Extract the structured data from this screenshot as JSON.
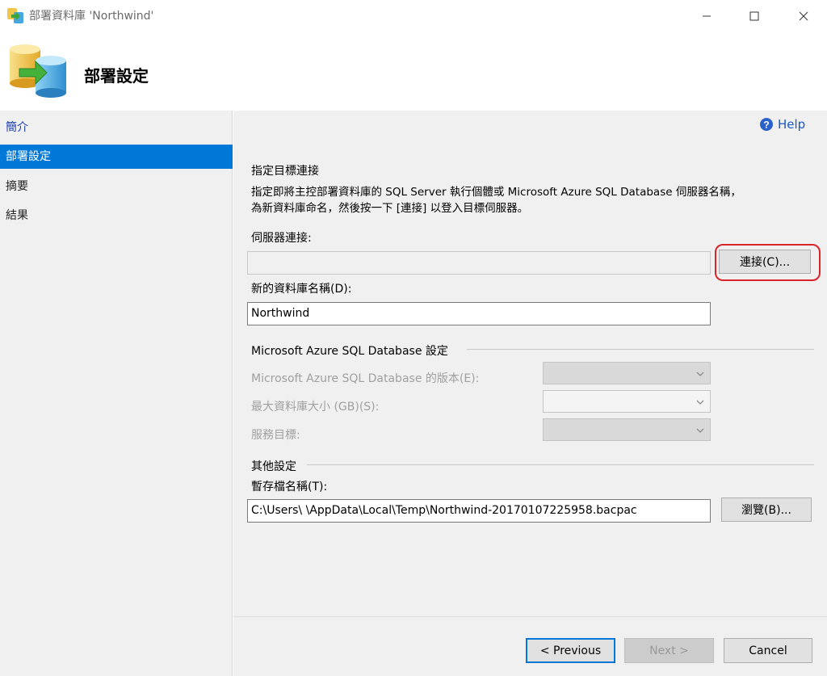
{
  "window": {
    "title": "部署資料庫 'Northwind'"
  },
  "header": {
    "title": "部署設定"
  },
  "sidebar": {
    "items": [
      {
        "label": "簡介"
      },
      {
        "label": "部署設定"
      },
      {
        "label": "摘要"
      },
      {
        "label": "結果"
      }
    ]
  },
  "help": {
    "label": "Help"
  },
  "target": {
    "heading": "指定目標連接",
    "description_line1": "指定即將主控部署資料庫的 SQL Server 執行個體或 Microsoft Azure SQL Database 伺服器名稱，",
    "description_line2": "為新資料庫命名，然後按一下 [連接] 以登入目標伺服器。",
    "server_label": "伺服器連接:",
    "server_value": "",
    "connect_button": "連接(C)...",
    "db_name_label": "新的資料庫名稱(D):",
    "db_name_value": "Northwind"
  },
  "azure": {
    "group_label": "Microsoft Azure SQL Database 設定",
    "edition_label": "Microsoft Azure SQL Database 的版本(E):",
    "max_size_label": "最大資料庫大小 (GB)(S):",
    "service_label": "服務目標:"
  },
  "other": {
    "group_label": "其他設定",
    "temp_file_label": "暫存檔名稱(T):",
    "temp_file_value": "C:\\Users\\                 \\AppData\\Local\\Temp\\Northwind-20170107225958.bacpac",
    "browse_button": "瀏覽(B)..."
  },
  "footer": {
    "previous": "< Previous",
    "next": "Next >",
    "cancel": "Cancel"
  },
  "colors": {
    "accent": "#0078d7",
    "highlight": "#d9252a"
  }
}
